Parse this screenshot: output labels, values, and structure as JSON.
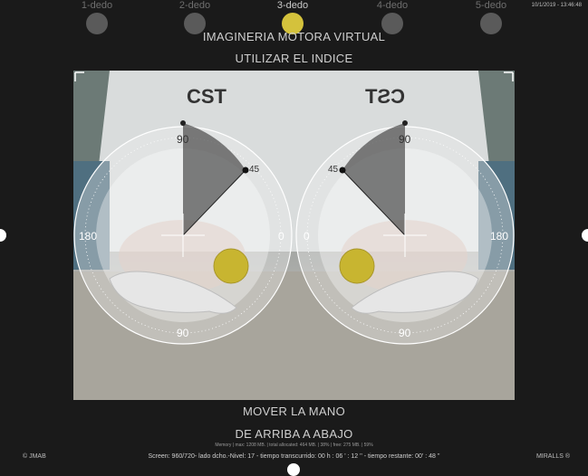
{
  "fingers": [
    {
      "label": "1-dedo",
      "active": false
    },
    {
      "label": "2-dedo",
      "active": false
    },
    {
      "label": "3-dedo",
      "active": true
    },
    {
      "label": "4-dedo",
      "active": false
    },
    {
      "label": "5-dedo",
      "active": false
    }
  ],
  "timestamp": "10/1/2019 - 13:46:48",
  "header": {
    "title": "IMAGINERIA MOTORA VIRTUAL",
    "subtitle": "UTILIZAR EL INDICE"
  },
  "scene": {
    "logo_left": "CST",
    "logo_right": "CST",
    "left_gauge": {
      "angle_marker": "45",
      "top_label": "90",
      "bottom_label": "90",
      "left_label": "180",
      "right_label": "0"
    },
    "right_gauge": {
      "angle_marker": "45",
      "top_label": "90",
      "bottom_label": "90",
      "left_label": "0",
      "right_label": "180"
    }
  },
  "instruction": {
    "line1": "MOVER LA MANO",
    "line2": "DE ARRIBA A ABAJO"
  },
  "memory": "Memory | max: 1208 MB. | total allocated: 464 MB. | 38% | free: 275 MB. | 59%",
  "status_line": "Screen: 960/720- lado dcho.-Nivel: 17 - tiempo transcurrido: 00 h : 06 ' : 12 '' - tiempo restante: 00' : 48 ''",
  "footer_left": "© JMAB",
  "footer_right": "MIRALLS ®",
  "colors": {
    "ball": "#c8b530",
    "active_dot": "#d4c23c",
    "background": "#1a1a1a"
  }
}
